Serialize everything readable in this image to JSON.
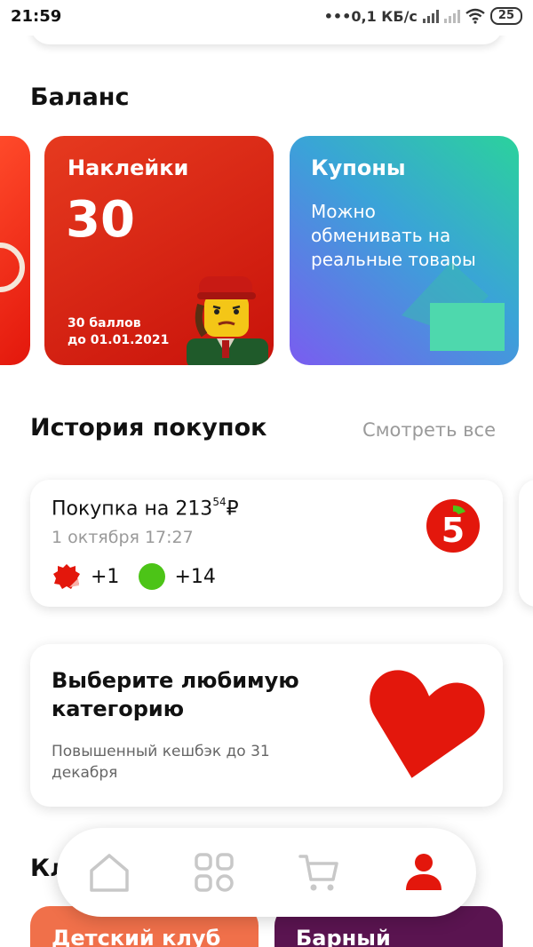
{
  "status_bar": {
    "time": "21:59",
    "network": "•••0,1 КБ/c",
    "battery": "25"
  },
  "balance": {
    "title": "Баланс",
    "stickers": {
      "title": "Наклейки",
      "count": "30",
      "note_line1": "30 баллов",
      "note_line2": "до 01.01.2021"
    },
    "coupons": {
      "title": "Купоны",
      "text": "Можно обменивать на реальные товары"
    }
  },
  "history": {
    "title": "История покупок",
    "see_all": "Смотреть все",
    "purchase": {
      "title_prefix": "Покупка на 213",
      "kopecks": "54",
      "currency": "₽",
      "date": "1 октября 17:27",
      "sticker_reward": "+1",
      "points_reward": "+14",
      "store_logo_text": "5"
    }
  },
  "category": {
    "title": "Выберите любимую категорию",
    "subtitle": "Повышенный кешбэк до 31 декабря"
  },
  "clubs": {
    "title": "Кл",
    "items": [
      {
        "label": "Детский клуб"
      },
      {
        "label": "Барный"
      }
    ]
  },
  "nav": {
    "items": [
      {
        "icon": "home-icon",
        "active": false
      },
      {
        "icon": "catalog-icon",
        "active": false
      },
      {
        "icon": "cart-icon",
        "active": false
      },
      {
        "icon": "profile-icon",
        "active": true
      }
    ]
  },
  "colors": {
    "accent_red": "#e3170c",
    "inactive_icon": "#c8c8c8",
    "reward_green": "#4cc417"
  }
}
